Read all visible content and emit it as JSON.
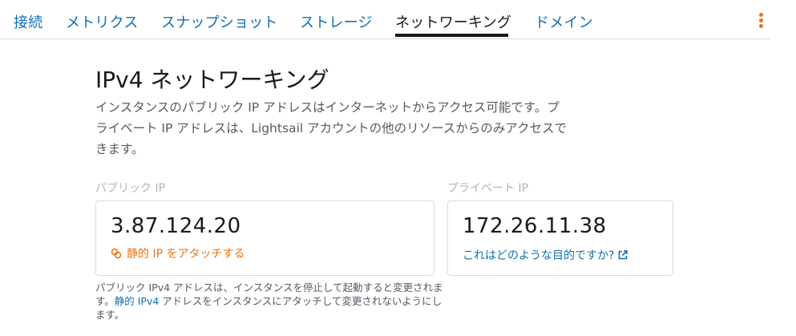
{
  "tabs": [
    {
      "label": "接続"
    },
    {
      "label": "メトリクス"
    },
    {
      "label": "スナップショット"
    },
    {
      "label": "ストレージ"
    },
    {
      "label": "ネットワーキング"
    },
    {
      "label": "ドメイン"
    }
  ],
  "active_tab": "ネットワーキング",
  "heading": "IPv4 ネットワーキング",
  "description": {
    "line1": "インスタンスのパブリック IP アドレスはインターネットからアクセス可能です。プ",
    "line2": "ライベート IP アドレスは、Lightsail アカウントの他のリソースからのみアクセスで",
    "line3": "きます。"
  },
  "public_ip": {
    "label": "パブリック IP",
    "value": "3.87.124.20",
    "attach_link": "静的 IP をアタッチする"
  },
  "private_ip": {
    "label": "プライベート IP",
    "value": "172.26.11.38",
    "help_link": "これはどのような目的ですか?"
  },
  "note": {
    "line1": "パブリック IPv4 アドレスは、インスタンスを停止して起動すると変更されま",
    "line2_prefix": "す。",
    "line2_link": "静的 IPv4",
    "line2_suffix": " アドレスをインスタンスにアタッチして変更されないようにし",
    "line3": "ます。"
  },
  "colors": {
    "link": "#0f6fb3",
    "accent_orange": "#ec7211",
    "highlight": "#ffff00",
    "border": "#d5dbdb",
    "muted_label": "#aab7b8"
  },
  "icons": [
    "attach-static-ip-icon",
    "external-link-icon",
    "more-options-icon"
  ]
}
